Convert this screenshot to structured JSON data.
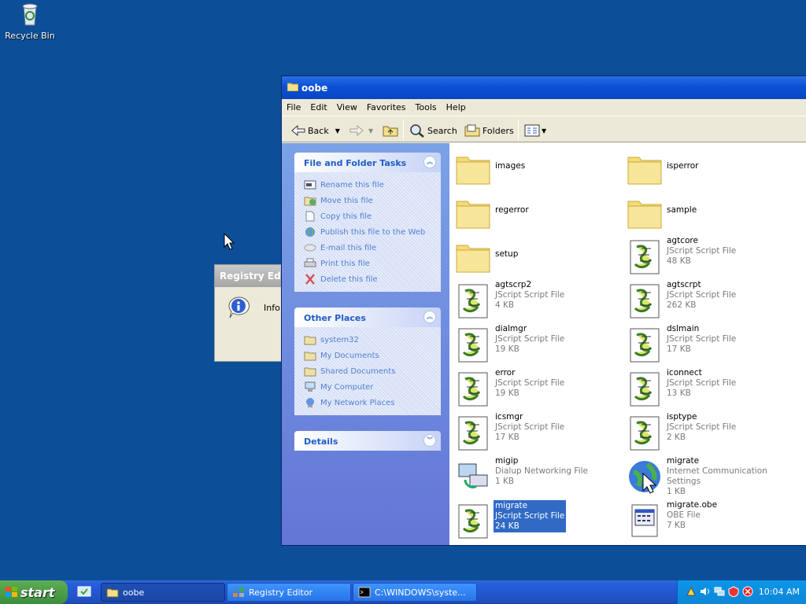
{
  "desktop": {
    "recycle_bin_label": "Recycle Bin",
    "registry_dialog": {
      "title": "Registry Edit",
      "text": "Info"
    }
  },
  "window": {
    "title": "oobe",
    "menu": [
      "File",
      "Edit",
      "View",
      "Favorites",
      "Tools",
      "Help"
    ],
    "toolbar": {
      "back": "Back",
      "search": "Search",
      "folders": "Folders"
    }
  },
  "tasks_panel": {
    "title": "File and Folder Tasks",
    "items": [
      {
        "label": "Rename this file",
        "icon": "rename-icon"
      },
      {
        "label": "Move this file",
        "icon": "move-icon"
      },
      {
        "label": "Copy this file",
        "icon": "copy-icon"
      },
      {
        "label": "Publish this file to the Web",
        "icon": "globe-icon"
      },
      {
        "label": "E-mail this file",
        "icon": "email-icon"
      },
      {
        "label": "Print this file",
        "icon": "printer-icon"
      },
      {
        "label": "Delete this file",
        "icon": "delete-icon"
      }
    ]
  },
  "places_panel": {
    "title": "Other Places",
    "items": [
      {
        "label": "system32",
        "icon": "folder-icon"
      },
      {
        "label": "My Documents",
        "icon": "folder-icon"
      },
      {
        "label": "Shared Documents",
        "icon": "folder-icon"
      },
      {
        "label": "My Computer",
        "icon": "computer-icon"
      },
      {
        "label": "My Network Places",
        "icon": "network-icon"
      }
    ]
  },
  "details_panel": {
    "title": "Details"
  },
  "files": [
    {
      "name": "images",
      "type": "",
      "size": "",
      "icon": "folder"
    },
    {
      "name": "isperror",
      "type": "",
      "size": "",
      "icon": "folder"
    },
    {
      "name": "regerror",
      "type": "",
      "size": "",
      "icon": "folder"
    },
    {
      "name": "sample",
      "type": "",
      "size": "",
      "icon": "folder"
    },
    {
      "name": "setup",
      "type": "",
      "size": "",
      "icon": "folder"
    },
    {
      "name": "agtcore",
      "type": "JScript Script File",
      "size": "48 KB",
      "icon": "script"
    },
    {
      "name": "agtscrp2",
      "type": "JScript Script File",
      "size": "4 KB",
      "icon": "script"
    },
    {
      "name": "agtscrpt",
      "type": "JScript Script File",
      "size": "262 KB",
      "icon": "script"
    },
    {
      "name": "dialmgr",
      "type": "JScript Script File",
      "size": "19 KB",
      "icon": "script"
    },
    {
      "name": "dslmain",
      "type": "JScript Script File",
      "size": "17 KB",
      "icon": "script"
    },
    {
      "name": "error",
      "type": "JScript Script File",
      "size": "19 KB",
      "icon": "script"
    },
    {
      "name": "iconnect",
      "type": "JScript Script File",
      "size": "13 KB",
      "icon": "script"
    },
    {
      "name": "icsmgr",
      "type": "JScript Script File",
      "size": "17 KB",
      "icon": "script"
    },
    {
      "name": "isptype",
      "type": "JScript Script File",
      "size": "2 KB",
      "icon": "script"
    },
    {
      "name": "migip",
      "type": "Dialup Networking File",
      "size": "1 KB",
      "icon": "dialup"
    },
    {
      "name": "migrate",
      "type": "Internet Communication Settings",
      "size": "1 KB",
      "icon": "ics"
    },
    {
      "name": "migrate",
      "type": "JScript Script File",
      "size": "24 KB",
      "icon": "script",
      "selected": true
    },
    {
      "name": "migrate.obe",
      "type": "OBE File",
      "size": "7 KB",
      "icon": "obe"
    }
  ],
  "taskbar": {
    "start": "start",
    "buttons": [
      {
        "label": "oobe",
        "icon": "folder-icon"
      },
      {
        "label": "Registry Editor",
        "icon": "registry-icon"
      },
      {
        "label": "C:\\WINDOWS\\syste...",
        "icon": "console-icon"
      }
    ],
    "clock": "10:04 AM"
  }
}
